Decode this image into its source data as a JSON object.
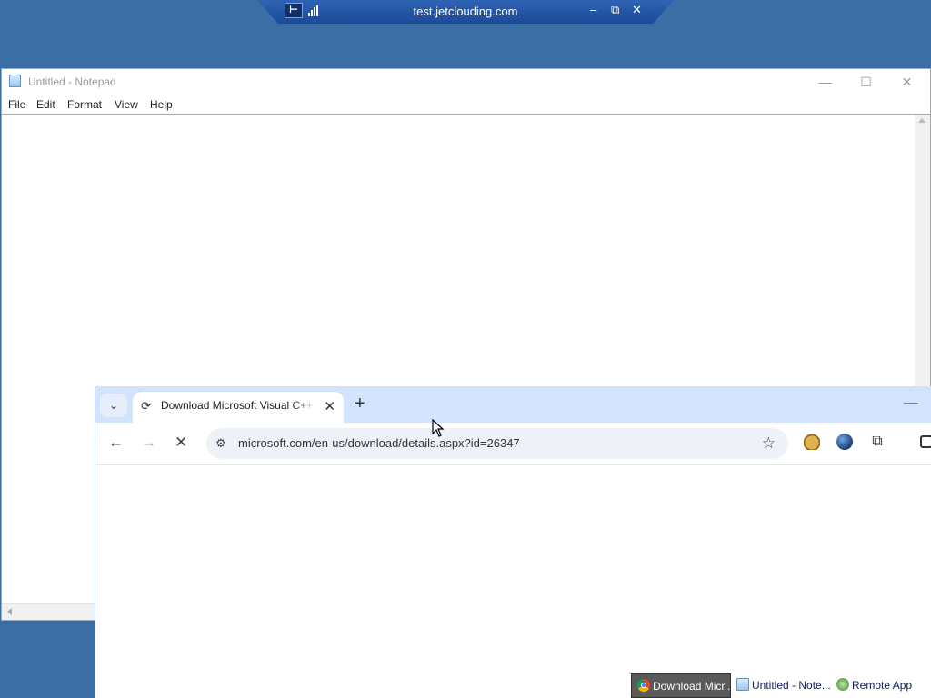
{
  "remote_bar": {
    "host": "test.jetclouding.com",
    "pin_glyph": "⊢",
    "minimize": "–",
    "restore": "⧉",
    "close": "✕"
  },
  "notepad": {
    "title": "Untitled - Notepad",
    "menu": [
      "File",
      "Edit",
      "Format",
      "View",
      "Help"
    ],
    "controls": {
      "minimize": "—",
      "maximize": "☐",
      "close": "✕"
    },
    "content": ""
  },
  "chrome": {
    "tab_search_glyph": "⌄",
    "tab": {
      "title": "Download Microsoft Visual C++",
      "close": "✕",
      "favicon": "⟳"
    },
    "new_tab": "+",
    "minimize": "—",
    "nav": {
      "back": "←",
      "forward": "→",
      "stop": "✕"
    },
    "url": "microsoft.com/en-us/download/details.aspx?id=26347",
    "site_info_glyph": "⚙",
    "star_glyph": "☆",
    "extensions": [
      "doge-extension-icon",
      "globe-extension-icon",
      "puzzle-extensions-icon",
      "side-panel-icon"
    ],
    "puzzle_glyph": "⧉"
  },
  "taskbar": {
    "items": [
      {
        "label": "Download Micr...",
        "icon": "chrome-icon",
        "active": true
      },
      {
        "label": "Untitled - Note...",
        "icon": "notepad-icon",
        "active": false
      },
      {
        "label": "Remote App",
        "icon": "remote-app-icon",
        "active": false
      }
    ]
  },
  "colors": {
    "desktop": "#3a6ea5",
    "chrome_tabstrip": "#d3e3fd",
    "remote_bar": "#1b4a97"
  }
}
